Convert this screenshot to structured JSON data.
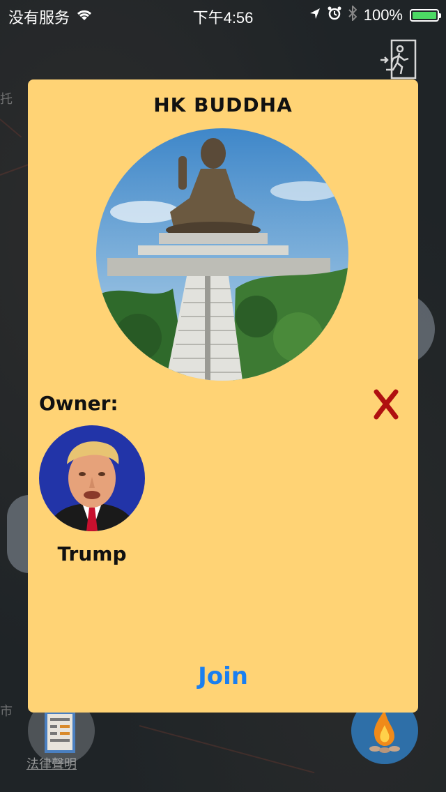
{
  "status_bar": {
    "carrier": "没有服务",
    "time": "下午4:56",
    "battery": "100%",
    "battery_level": 1.0,
    "icons": [
      "wifi-icon",
      "location-arrow-icon",
      "alarm-icon",
      "bluetooth-icon",
      "battery-icon"
    ]
  },
  "map": {
    "label_top_left": "托",
    "label_bottom_left": "市",
    "list_button_caption": "法律聲明"
  },
  "card": {
    "title": "HK BUDDHA",
    "owner_label": "Owner:",
    "owner_name": "Trump",
    "join_label": "Join",
    "close_icon": "close-x-icon"
  },
  "colors": {
    "card_background": "#ffd375",
    "join_text": "#1a7ff0",
    "close_x": "#b01010"
  }
}
